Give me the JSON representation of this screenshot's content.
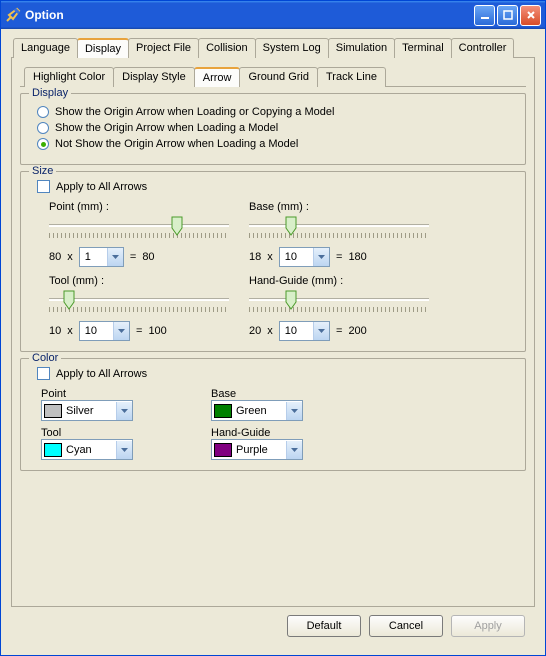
{
  "window": {
    "title": "Option"
  },
  "tabs": {
    "language": "Language",
    "display": "Display",
    "project_file": "Project File",
    "collision": "Collision",
    "system_log": "System Log",
    "simulation": "Simulation",
    "terminal": "Terminal",
    "controller": "Controller"
  },
  "subtabs": {
    "highlight_color": "Highlight Color",
    "display_style": "Display Style",
    "arrow": "Arrow",
    "ground_grid": "Ground Grid",
    "track_line": "Track Line"
  },
  "display_group": {
    "label": "Display",
    "opt1": "Show the Origin Arrow when Loading or Copying a Model",
    "opt2": "Show the Origin Arrow when Loading a Model",
    "opt3": "Not Show the Origin Arrow when Loading a Model"
  },
  "size_group": {
    "label": "Size",
    "apply_all": "Apply to All Arrows",
    "point": {
      "label": "Point (mm) :",
      "base": "80",
      "x": "x",
      "mult": "1",
      "eq": "=",
      "result": "80",
      "thumb_pos": "68%"
    },
    "base": {
      "label": "Base (mm) :",
      "base": "18",
      "x": "x",
      "mult": "10",
      "eq": "=",
      "result": "180",
      "thumb_pos": "20%"
    },
    "tool": {
      "label": "Tool (mm) :",
      "base": "10",
      "x": "x",
      "mult": "10",
      "eq": "=",
      "result": "100",
      "thumb_pos": "8%"
    },
    "hand": {
      "label": "Hand-Guide (mm) :",
      "base": "20",
      "x": "x",
      "mult": "10",
      "eq": "=",
      "result": "200",
      "thumb_pos": "20%"
    }
  },
  "color_group": {
    "label": "Color",
    "apply_all": "Apply to All Arrows",
    "point": {
      "label": "Point",
      "name": "Silver",
      "hex": "#c0c0c0"
    },
    "base": {
      "label": "Base",
      "name": "Green",
      "hex": "#008000"
    },
    "tool": {
      "label": "Tool",
      "name": "Cyan",
      "hex": "#00ffff"
    },
    "hand": {
      "label": "Hand-Guide",
      "name": "Purple",
      "hex": "#800080"
    }
  },
  "buttons": {
    "default": "Default",
    "cancel": "Cancel",
    "apply": "Apply"
  }
}
